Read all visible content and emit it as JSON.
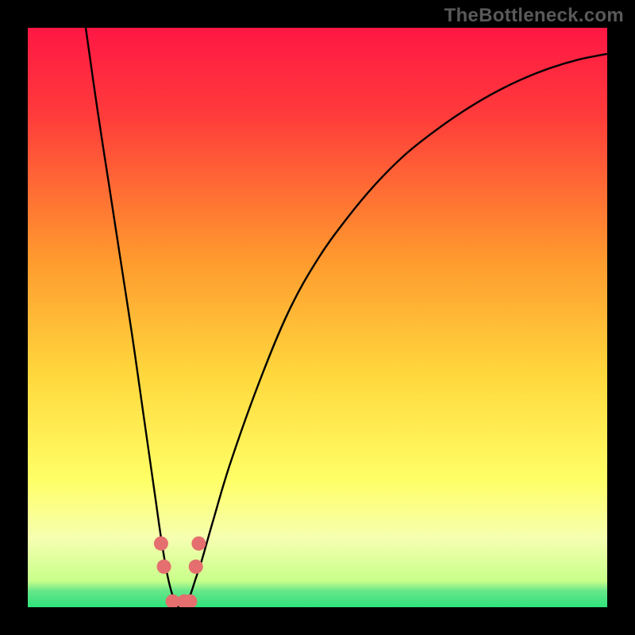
{
  "watermark": "TheBottleneck.com",
  "chart_data": {
    "type": "line",
    "title": "",
    "xlabel": "",
    "ylabel": "",
    "xlim": [
      0,
      100
    ],
    "ylim": [
      0,
      100
    ],
    "optimum_x": 26,
    "gradient_stops": [
      {
        "offset": 0.0,
        "color": "#ff1744"
      },
      {
        "offset": 0.15,
        "color": "#ff3b3b"
      },
      {
        "offset": 0.4,
        "color": "#ff9a2e"
      },
      {
        "offset": 0.6,
        "color": "#ffd83d"
      },
      {
        "offset": 0.78,
        "color": "#ffff66"
      },
      {
        "offset": 0.88,
        "color": "#f6ffb0"
      },
      {
        "offset": 0.955,
        "color": "#c8ff8a"
      },
      {
        "offset": 0.972,
        "color": "#66e68a"
      },
      {
        "offset": 1.0,
        "color": "#2ee37a"
      }
    ],
    "series": [
      {
        "name": "bottleneck-curve",
        "x": [
          10,
          12,
          14,
          16,
          18,
          20,
          21,
          22,
          23,
          24,
          25,
          26,
          27,
          28,
          29,
          30,
          32,
          35,
          40,
          45,
          50,
          55,
          60,
          65,
          70,
          75,
          80,
          85,
          90,
          95,
          100
        ],
        "y": [
          100,
          86,
          73,
          60,
          47,
          33,
          26,
          19,
          12,
          6,
          2,
          0,
          0,
          2,
          5,
          8,
          15,
          25,
          39,
          51,
          60,
          67,
          73,
          78,
          82,
          85.5,
          88.5,
          91,
          93,
          94.5,
          95.5
        ]
      }
    ],
    "markers": [
      {
        "x": 23.0,
        "y": 11.0,
        "color": "#e46f6e"
      },
      {
        "x": 23.5,
        "y": 7.0,
        "color": "#e46f6e"
      },
      {
        "x": 25.0,
        "y": 1.0,
        "color": "#e46f6e"
      },
      {
        "x": 27.0,
        "y": 1.0,
        "color": "#e46f6e"
      },
      {
        "x": 28.0,
        "y": 1.0,
        "color": "#e46f6e"
      },
      {
        "x": 29.0,
        "y": 7.0,
        "color": "#e46f6e"
      },
      {
        "x": 29.5,
        "y": 11.0,
        "color": "#e46f6e"
      }
    ],
    "curve_stroke": "#000000",
    "curve_width": 2.4,
    "marker_radius": 9
  }
}
